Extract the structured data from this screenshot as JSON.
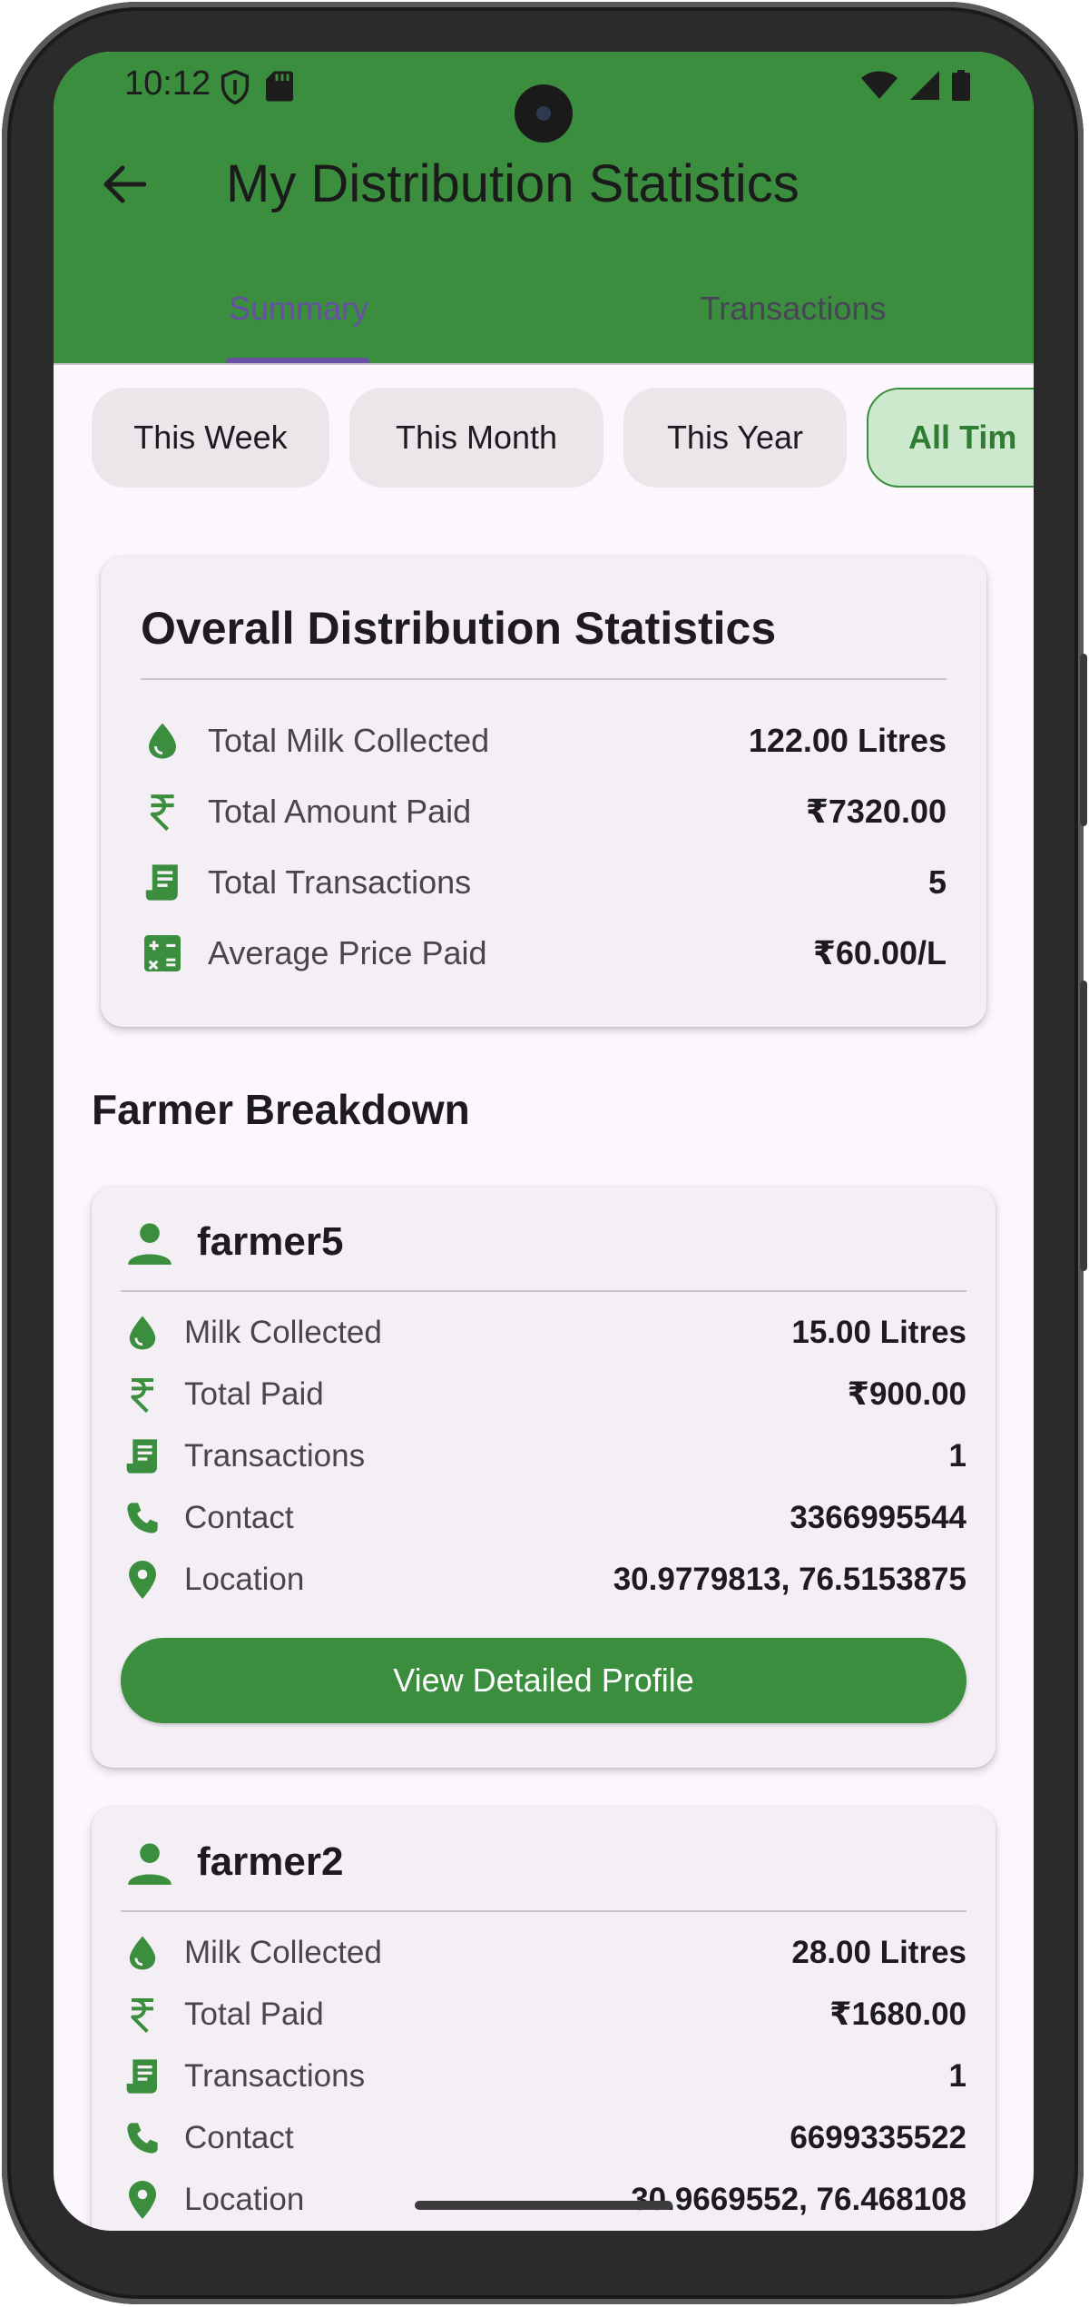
{
  "status_bar": {
    "time": "10:12"
  },
  "app_bar": {
    "title": "My Distribution Statistics"
  },
  "tabs": [
    {
      "label": "Summary",
      "selected": true
    },
    {
      "label": "Transactions",
      "selected": false
    }
  ],
  "filters": [
    {
      "label": "This Week",
      "selected": false
    },
    {
      "label": "This Month",
      "selected": false
    },
    {
      "label": "This Year",
      "selected": false
    },
    {
      "label": "All Tim",
      "selected": true
    }
  ],
  "overall": {
    "title": "Overall Distribution Statistics",
    "rows": [
      {
        "icon": "water-drop-icon",
        "label": "Total Milk Collected",
        "value": "122.00 Litres"
      },
      {
        "icon": "rupee-icon",
        "label": "Total Amount Paid",
        "value": "₹7320.00"
      },
      {
        "icon": "receipt-icon",
        "label": "Total Transactions",
        "value": "5"
      },
      {
        "icon": "calculator-icon",
        "label": "Average Price Paid",
        "value": "₹60.00/L"
      }
    ]
  },
  "section_title": "Farmer Breakdown",
  "farmers": [
    {
      "name": "farmer5",
      "rows": [
        {
          "icon": "water-drop-icon",
          "label": "Milk Collected",
          "value": "15.00 Litres"
        },
        {
          "icon": "rupee-icon",
          "label": "Total Paid",
          "value": "₹900.00"
        },
        {
          "icon": "receipt-icon",
          "label": "Transactions",
          "value": "1"
        },
        {
          "icon": "phone-icon",
          "label": "Contact",
          "value": "3366995544"
        },
        {
          "icon": "location-pin-icon",
          "label": "Location",
          "value": "30.9779813, 76.5153875"
        }
      ],
      "button": "View Detailed Profile"
    },
    {
      "name": "farmer2",
      "rows": [
        {
          "icon": "water-drop-icon",
          "label": "Milk Collected",
          "value": "28.00 Litres"
        },
        {
          "icon": "rupee-icon",
          "label": "Total Paid",
          "value": "₹1680.00"
        },
        {
          "icon": "receipt-icon",
          "label": "Transactions",
          "value": "1"
        },
        {
          "icon": "phone-icon",
          "label": "Contact",
          "value": "6699335522"
        },
        {
          "icon": "location-pin-icon",
          "label": "Location",
          "value": "30.9669552, 76.468108"
        }
      ]
    }
  ],
  "colors": {
    "primary": "#3a8e3e",
    "tab_active": "#6750a4",
    "background": "#fbf7fd",
    "card": "#f3eff5"
  }
}
